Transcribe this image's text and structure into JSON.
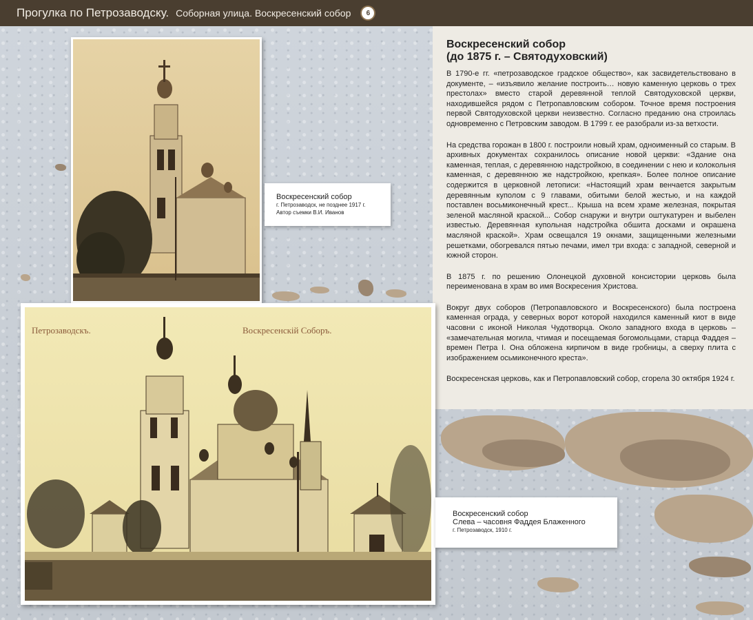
{
  "header": {
    "title": "Прогулка по Петрозаводску.",
    "subtitle": "Соборная улица. Воскресенский собор",
    "page_number": "6"
  },
  "article": {
    "title_line1": "Воскресенский собор",
    "title_line2": "(до 1875 г. – Святодуховский)",
    "paragraphs": [
      "В 1790-е гг. «петрозаводское градское общество», как засвидетельствовано в документе, – «изъявило желание построить… новую каменную церковь о трех престолах» вместо старой деревянной теплой Святодуховской церкви, находившейся рядом с Петропавловским собором. Точное время построения первой Святодуховской церкви неизвестно. Согласно преданию она строилась одновременно с Петровским заводом. В 1799 г. ее разобрали из-за ветхости.",
      "На средства горожан в 1800 г. построили новый храм, одноименный со старым. В архивных документах сохранилось описание новой церкви: «Здание она каменная, теплая, с деревянною надстройкою, в соединении с нею и колокольня каменная, с деревянною же надстройкою, крепкая». Более полное описание содержится в церковной летописи: «Настоящий храм венчается закрытым деревянным куполом с 9 главами, обитыми белой жестью, и на каждой поставлен восьмиконечный крест... Крыша на всем храме железная, покрытая зеленой масляной краской... Собор снаружи и внутри оштукатурен и выбелен известью. Деревянная купольная надстройка обшита досками и окрашена масляной краской». Храм освещался 19 окнами, защищенными железными решетками, обогревался пятью печами, имел три входа: с западной, северной и южной сторон.",
      "В 1875 г. по решению Олонецкой духовной консистории церковь была переименована в храм во имя Воскресения Христова.",
      "Вокруг двух соборов (Петропавловского и Воскресенского) была построена каменная ограда, у северных ворот которой находился каменный киот в виде часовни с иконой Николая Чудотворца. Около западного входа в церковь – «замечательная могила, чтимая и посещаемая богомольцами, старца Фаддея – времен Петра I. Она обложена кирпичом в виде гробницы, а сверху плита с изображением осьмиконечного креста».",
      "Воскресенская церковь, как и Петропавловский собор, сгорела 30 октября 1924 г."
    ]
  },
  "photo1": {
    "caption_title": "Воскресенский собор",
    "caption_line1": "г. Петрозаводск, не позднее 1917 г.",
    "caption_line2": "Автор съемки В.И. Иванов"
  },
  "photo2": {
    "inscription_left": "Петрозаводскъ.",
    "inscription_right": "Воскресенскiй Соборъ.",
    "caption_title": "Воскресенский собор",
    "caption_line2": "Слева – часовня Фаддея Блаженного",
    "caption_line3": "г. Петрозаводск, 1910 г."
  }
}
